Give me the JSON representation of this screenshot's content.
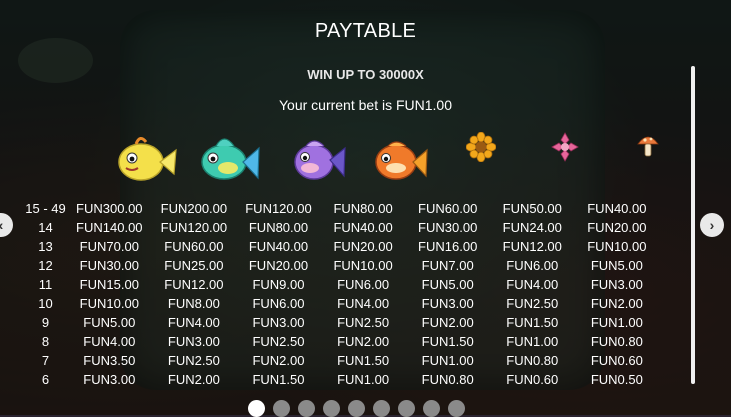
{
  "title": "PAYTABLE",
  "subtitle": "WIN UP TO 30000X",
  "bet": {
    "prefix": "Your current bet is ",
    "amount": "FUN1.00"
  },
  "symbols": [
    {
      "name": "yellow-fish-icon",
      "color": "#f4e04a"
    },
    {
      "name": "green-fish-icon",
      "color": "#3ecbb0"
    },
    {
      "name": "purple-fish-icon",
      "color": "#a071e0"
    },
    {
      "name": "orange-fish-icon",
      "color": "#f07a2a"
    },
    {
      "name": "sunflower-icon",
      "color": "#f2a71b"
    },
    {
      "name": "pink-flower-icon",
      "color": "#e6659a"
    },
    {
      "name": "mushroom-icon",
      "color": "#e9783a"
    }
  ],
  "rows": [
    {
      "count": "15 - 49",
      "values": [
        "FUN300.00",
        "FUN200.00",
        "FUN120.00",
        "FUN80.00",
        "FUN60.00",
        "FUN50.00",
        "FUN40.00"
      ]
    },
    {
      "count": "14",
      "values": [
        "FUN140.00",
        "FUN120.00",
        "FUN80.00",
        "FUN40.00",
        "FUN30.00",
        "FUN24.00",
        "FUN20.00"
      ]
    },
    {
      "count": "13",
      "values": [
        "FUN70.00",
        "FUN60.00",
        "FUN40.00",
        "FUN20.00",
        "FUN16.00",
        "FUN12.00",
        "FUN10.00"
      ]
    },
    {
      "count": "12",
      "values": [
        "FUN30.00",
        "FUN25.00",
        "FUN20.00",
        "FUN10.00",
        "FUN7.00",
        "FUN6.00",
        "FUN5.00"
      ]
    },
    {
      "count": "11",
      "values": [
        "FUN15.00",
        "FUN12.00",
        "FUN9.00",
        "FUN6.00",
        "FUN5.00",
        "FUN4.00",
        "FUN3.00"
      ]
    },
    {
      "count": "10",
      "values": [
        "FUN10.00",
        "FUN8.00",
        "FUN6.00",
        "FUN4.00",
        "FUN3.00",
        "FUN2.50",
        "FUN2.00"
      ]
    },
    {
      "count": "9",
      "values": [
        "FUN5.00",
        "FUN4.00",
        "FUN3.00",
        "FUN2.50",
        "FUN2.00",
        "FUN1.50",
        "FUN1.00"
      ]
    },
    {
      "count": "8",
      "values": [
        "FUN4.00",
        "FUN3.00",
        "FUN2.50",
        "FUN2.00",
        "FUN1.50",
        "FUN1.00",
        "FUN0.80"
      ]
    },
    {
      "count": "7",
      "values": [
        "FUN3.50",
        "FUN2.50",
        "FUN2.00",
        "FUN1.50",
        "FUN1.00",
        "FUN0.80",
        "FUN0.60"
      ]
    },
    {
      "count": "6",
      "values": [
        "FUN3.00",
        "FUN2.00",
        "FUN1.50",
        "FUN1.00",
        "FUN0.80",
        "FUN0.60",
        "FUN0.50"
      ]
    }
  ],
  "pagination": {
    "total_pages": 9,
    "current_page": 1
  },
  "colors": {
    "text": "#ffffff",
    "overlay": "rgba(0,0,0,0.55)",
    "dot_active": "#ffffff",
    "dot_inactive": "#8a8a8a"
  }
}
